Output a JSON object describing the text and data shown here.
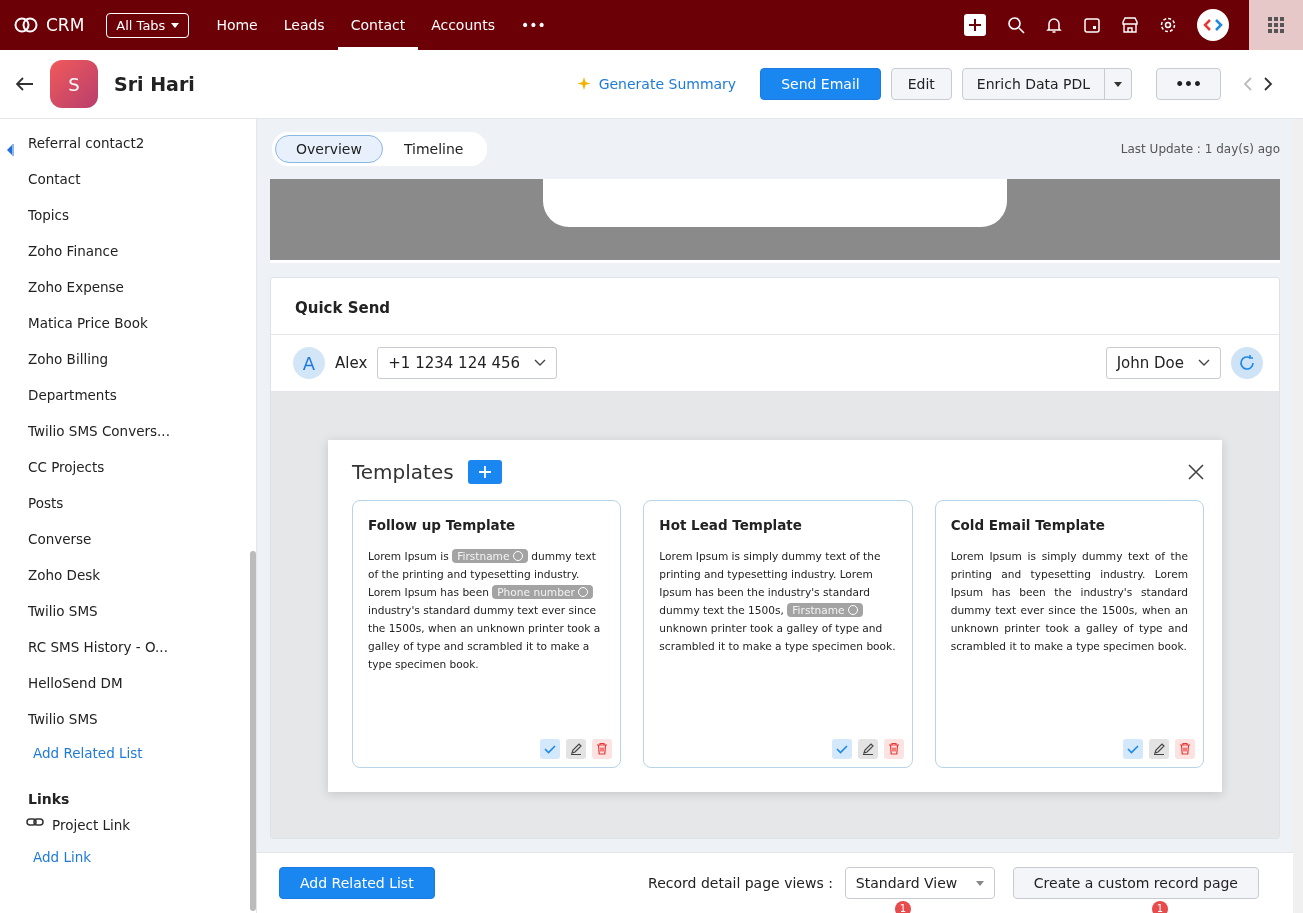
{
  "topbar": {
    "logo": "CRM",
    "all_tabs": "All Tabs",
    "nav": [
      {
        "label": "Home",
        "selected": false
      },
      {
        "label": "Leads",
        "selected": false
      },
      {
        "label": "Contact",
        "selected": true
      },
      {
        "label": "Accounts",
        "selected": false
      }
    ],
    "more": "•••"
  },
  "record": {
    "avatar": "S",
    "name": "Sri Hari",
    "generate_summary": "Generate Summary",
    "send_email": "Send Email",
    "edit": "Edit",
    "enrich": "Enrich Data PDL",
    "more": "•••"
  },
  "sidebar": {
    "items": [
      "Referral contact2",
      "Contact",
      "Topics",
      "Zoho Finance",
      "Zoho Expense",
      "Matica Price Book",
      "Zoho Billing",
      "Departments",
      "Twilio SMS Convers...",
      "CC Projects",
      "Posts",
      "Converse",
      "Zoho Desk",
      "Twilio SMS",
      "RC SMS History - O...",
      "HelloSend DM",
      "Twilio SMS"
    ],
    "add_related_list": "Add Related List",
    "links_heading": "Links",
    "links": [
      "Project Link"
    ],
    "add_link": "Add Link"
  },
  "view_tabs": [
    {
      "label": "Overview",
      "selected": true
    },
    {
      "label": "Timeline",
      "selected": false
    }
  ],
  "last_update": "Last Update : 1 day(s) ago",
  "quick_send": {
    "title": "Quick Send",
    "contact_initial": "A",
    "contact_name": "Alex",
    "phone": "+1 1234 124 456",
    "sender": "John Doe"
  },
  "templates_modal": {
    "title": "Templates",
    "cards": [
      {
        "title": "Follow up Template",
        "justified": false,
        "body": [
          {
            "kind": "text",
            "text": "Lorem Ipsum is "
          },
          {
            "kind": "chip",
            "text": "Firstname"
          },
          {
            "kind": "text",
            "text": " dummy text of the printing and typesetting industry. Lorem Ipsum has been "
          },
          {
            "kind": "chip",
            "text": "Phone number"
          },
          {
            "kind": "text",
            "text": " industry's standard dummy text ever since the 1500s, when an unknown printer took a galley of type and scrambled it to make a type specimen book."
          }
        ]
      },
      {
        "title": "Hot Lead Template",
        "justified": false,
        "body": [
          {
            "kind": "text",
            "text": "Lorem Ipsum is simply dummy text of the printing and typesetting industry. Lorem Ipsum has been the industry's standard dummy text the 1500s, "
          },
          {
            "kind": "chip",
            "text": "Firstname"
          },
          {
            "kind": "text",
            "text": " unknown printer took a galley of type and scrambled it to make a type specimen book."
          }
        ]
      },
      {
        "title": "Cold Email Template",
        "justified": true,
        "body": [
          {
            "kind": "text",
            "text": "Lorem Ipsum is simply dummy text of the printing and typesetting industry. Lorem Ipsum has been the industry's standard dummy text ever since the 1500s, when an unknown printer took a galley of type and scrambled it to make a type specimen book."
          }
        ]
      }
    ]
  },
  "footer": {
    "add_related_list": "Add Related List",
    "views_label": "Record detail page views :",
    "view_value": "Standard View",
    "create_custom": "Create a custom record page",
    "badges": [
      "1",
      "1"
    ]
  }
}
